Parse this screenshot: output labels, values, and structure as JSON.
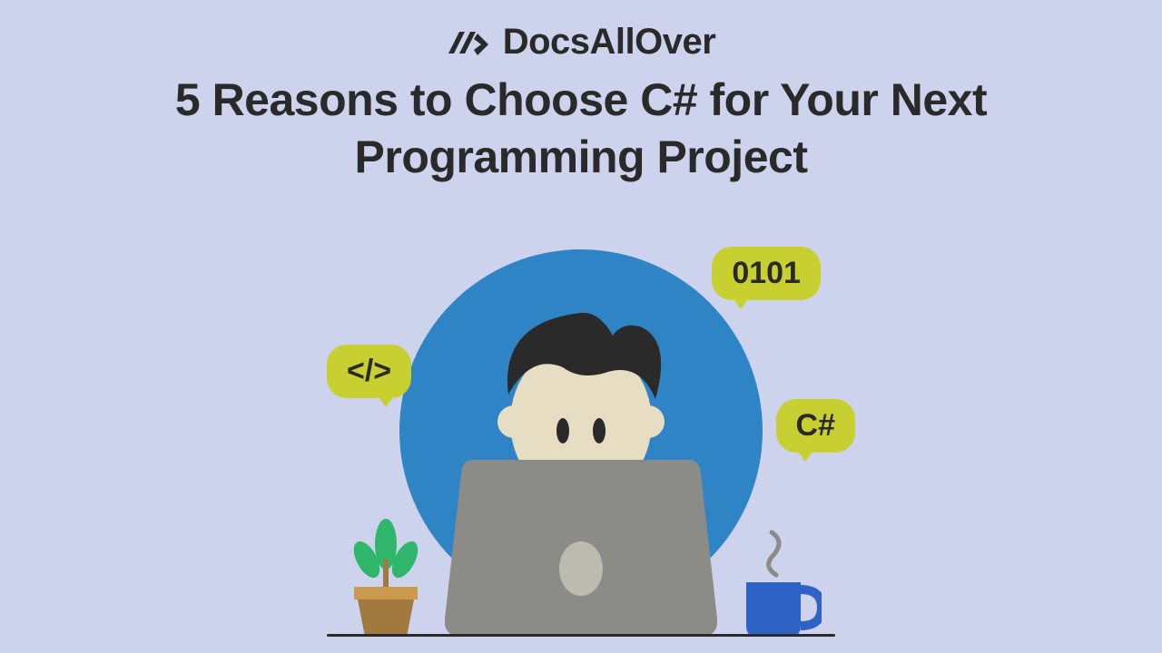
{
  "brand": "DocsAllOver",
  "headline": "5 Reasons to Choose C# for Your Next Programming Project",
  "bubbles": {
    "code": "</>",
    "binary": "0101",
    "csharp": "C#"
  },
  "colors": {
    "background": "#cdd3ed",
    "circle": "#2e84c5",
    "bubble": "#c8cf31",
    "text": "#2a2a2a"
  }
}
